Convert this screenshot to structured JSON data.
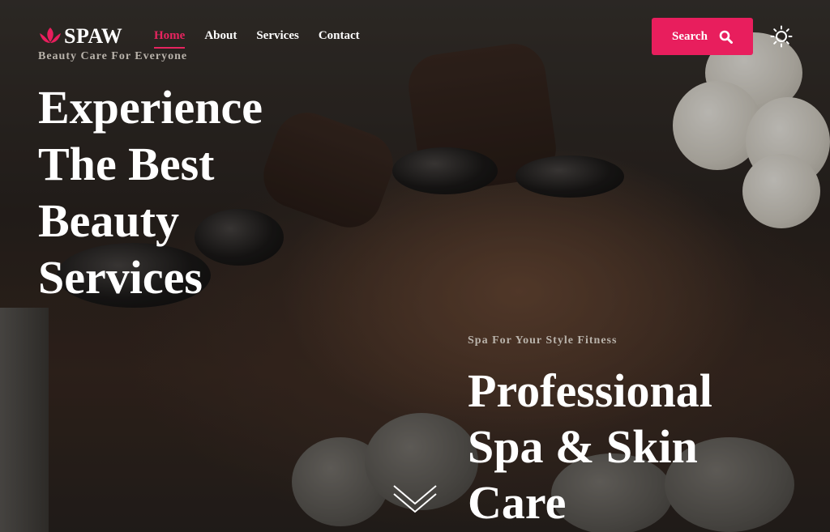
{
  "brand": {
    "name": "SPAW",
    "tagline": "Beauty Care For Everyone",
    "accent_color": "#e81e5d",
    "logo_icon": "lotus-icon"
  },
  "nav": {
    "items": [
      {
        "label": "Home",
        "active": true
      },
      {
        "label": "About",
        "active": false
      },
      {
        "label": "Services",
        "active": false
      },
      {
        "label": "Contact",
        "active": false
      }
    ]
  },
  "search": {
    "label": "Search",
    "icon": "search-icon"
  },
  "theme_toggle": {
    "icon": "sun-icon"
  },
  "hero": {
    "headline": "Experience The Best Beauty Services",
    "kicker": "Spa For Your Style Fitness",
    "subheadline": "Professional Spa & Skin Care",
    "scroll_icon": "chevron-down-icon"
  }
}
